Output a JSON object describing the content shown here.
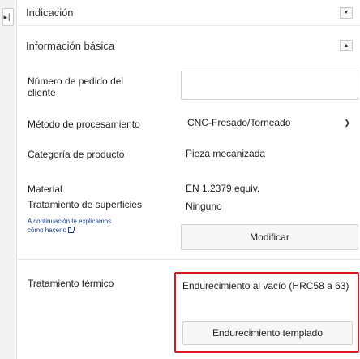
{
  "sidebar": {
    "toggle_icon": "expand-right-icon"
  },
  "sections": {
    "indicacion": {
      "title": "Indicación",
      "icon": "chevron-down-icon"
    },
    "basica": {
      "title": "Información básica",
      "icon": "chevron-up-icon"
    }
  },
  "form": {
    "order_number": {
      "label": "Número de pedido del cliente",
      "value": ""
    },
    "method": {
      "label": "Método de procesamiento",
      "value": "CNC-Fresado/Torneado",
      "icon": "chevron-down-icon"
    },
    "category": {
      "label": "Categoría de producto",
      "value": "Pieza mecanizada"
    },
    "material": {
      "label": "Material",
      "value": "EN 1.2379 equiv."
    },
    "surface": {
      "label": "Tratamiento de superficies",
      "value": "Ninguno",
      "help_link": "A continuación te explicamos cómo hacerlo",
      "help_icon": "external-link-icon"
    },
    "modify_button": "Modificar",
    "heat": {
      "label": "Tratamiento térmico",
      "value": "Endurecimiento al vacío (HRC58 a 63)",
      "button": "Endurecimiento templado"
    }
  },
  "colors": {
    "highlight": "#d9191f",
    "link": "#1b3f8f"
  }
}
